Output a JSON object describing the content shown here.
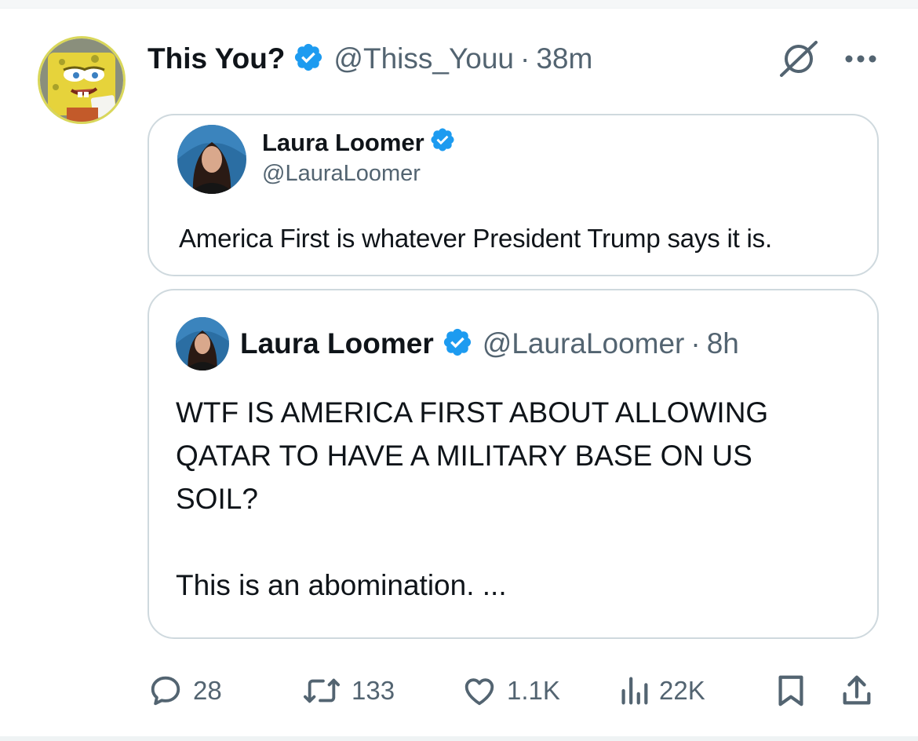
{
  "post": {
    "author_name": "This You?",
    "author_handle": "@Thiss_Youu",
    "separator": "·",
    "time": "38m"
  },
  "quote": {
    "author_name": "Laura Loomer",
    "author_handle": "@LauraLoomer",
    "text": "America First is whatever President Trump says it is."
  },
  "nested": {
    "author_name": "Laura Loomer",
    "author_handle": "@LauraLoomer",
    "separator": "·",
    "time": "8h",
    "line1": "WTF IS AMERICA FIRST ABOUT ALLOWING",
    "line2": "QATAR TO HAVE A MILITARY BASE ON US",
    "line3": "SOIL?",
    "line4": "This is an abomination. ..."
  },
  "actions": {
    "replies": "28",
    "reposts": "133",
    "likes": "1.1K",
    "views": "22K"
  },
  "icons": {
    "verified": "verified-badge-icon",
    "grok": "grok-icon",
    "more": "more-icon",
    "reply": "reply-icon",
    "repost": "repost-icon",
    "like": "heart-icon",
    "views": "views-icon",
    "bookmark": "bookmark-icon",
    "share": "share-icon"
  },
  "colors": {
    "verified_blue": "#1d9bf0",
    "text_primary": "#0f1419",
    "text_secondary": "#536471",
    "border": "#cfd9de"
  }
}
